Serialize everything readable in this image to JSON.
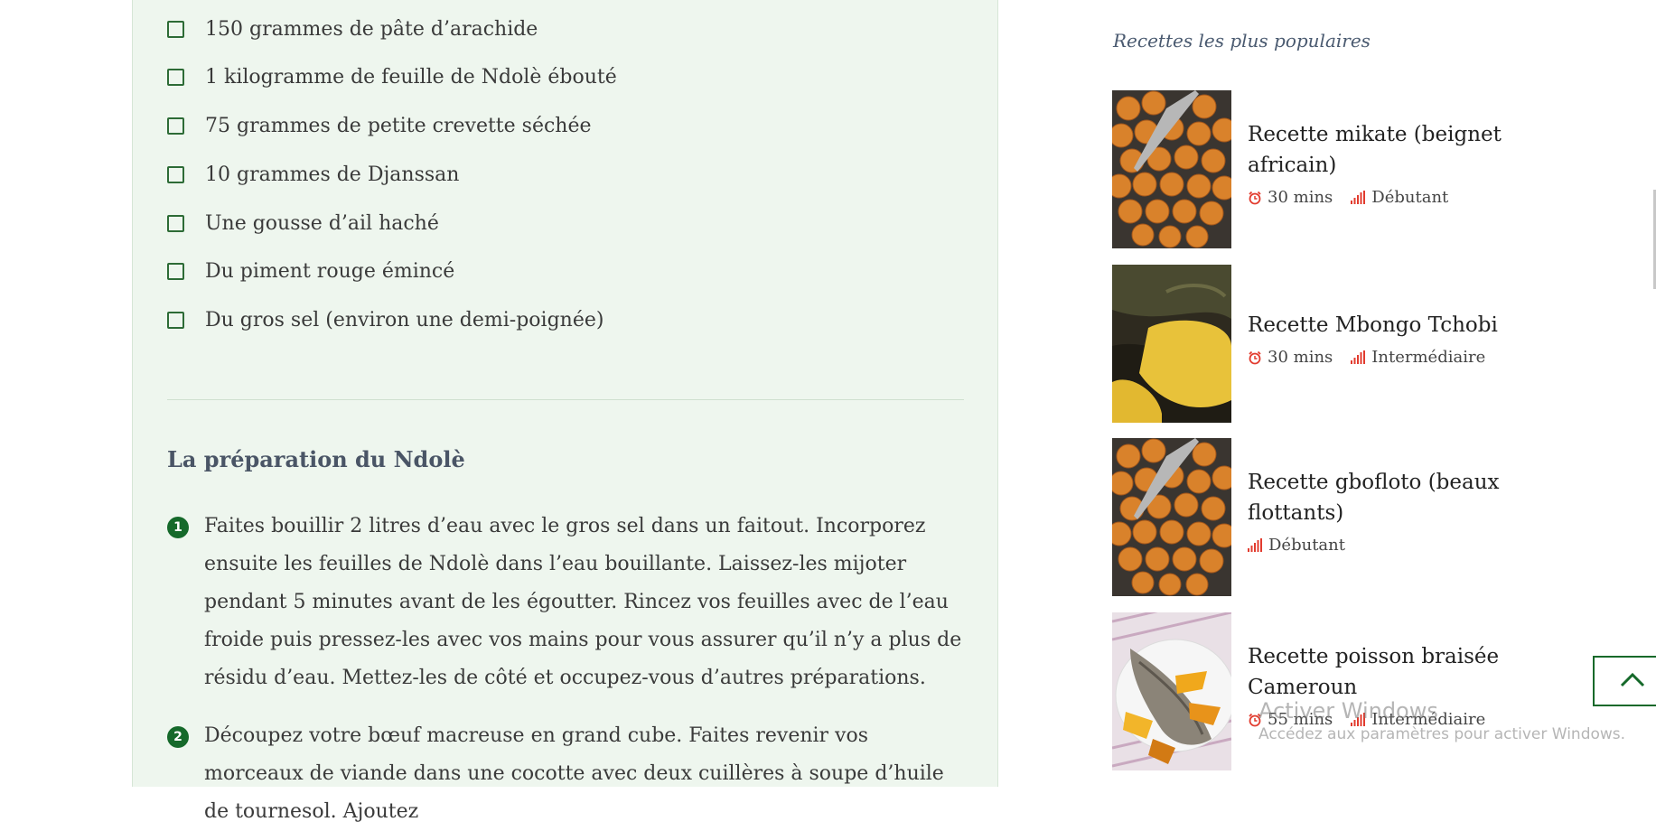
{
  "ingredients": [
    "150 grammes de pâte d’arachide",
    "1 kilogramme de feuille de Ndolè ébouté",
    "75 grammes de petite crevette séchée",
    "10 grammes de Djanssan",
    "Une gousse d’ail haché",
    "Du piment rouge émincé",
    "Du gros sel (environ une demi-poignée)"
  ],
  "preparation": {
    "title": "La préparation du Ndolè",
    "steps": [
      {
        "number": "1",
        "text": "Faites bouillir 2 litres d’eau avec le gros sel dans un faitout. Incorporez ensuite les feuilles de Ndolè dans l’eau bouillante. Laissez-les mijoter pendant 5 minutes avant de les égoutter. Rincez vos feuilles avec de l’eau froide puis pressez-les avec vos mains pour vous assurer qu’il n’y a plus de résidu d’eau. Mettez-les de côté et occupez-vous d’autres préparations."
      },
      {
        "number": "2",
        "text": "Découpez votre bœuf macreuse en grand cube. Faites revenir vos morceaux de viande dans une cocotte avec deux cuillères à soupe d’huile de tournesol. Ajoutez"
      }
    ]
  },
  "sidebar": {
    "title": "Recettes les plus populaires",
    "recipes": [
      {
        "title": "Recette mikate (beignet africain)",
        "time": "30 mins",
        "level": "Débutant",
        "image": "fried-dough-balls"
      },
      {
        "title": "Recette Mbongo Tchobi",
        "time": "30 mins",
        "level": "Intermédiaire",
        "image": "plantain-dark-sauce"
      },
      {
        "title": "Recette gbofloto (beaux flottants)",
        "time": "",
        "level": "Débutant",
        "image": "fried-dough-balls"
      },
      {
        "title": "Recette poisson braisée Cameroun",
        "time": "55 mins",
        "level": "Intermédiaire",
        "image": "grilled-fish-plate"
      }
    ]
  },
  "icons": {
    "time": "alarm-clock-icon",
    "level": "signal-bars-icon",
    "back_to_top": "chevron-up-icon"
  },
  "colors": {
    "panel_background": "#eef6ee",
    "accent_green": "#15692a",
    "meta_icon_red": "#e23b2e"
  },
  "watermark": {
    "line1": "Activer Windows",
    "line2": "Accédez aux paramètres pour activer Windows."
  }
}
